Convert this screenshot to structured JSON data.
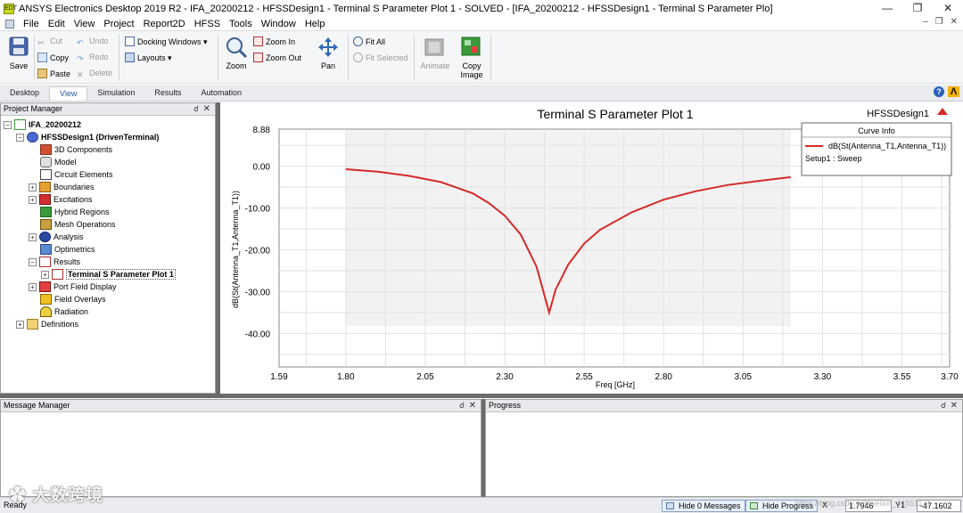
{
  "window": {
    "title": "ANSYS Electronics Desktop 2019 R2 - IFA_20200212 - HFSSDesign1 - Terminal S Parameter Plot 1 - SOLVED - [IFA_20200212 - HFSSDesign1 - Terminal S Parameter Plo]",
    "icon_text": "EDT"
  },
  "menu": [
    "File",
    "Edit",
    "View",
    "Project",
    "Report2D",
    "HFSS",
    "Tools",
    "Window",
    "Help"
  ],
  "ribbon": {
    "save": "Save",
    "cut": "Cut",
    "copy": "Copy",
    "paste": "Paste",
    "undo": "Undo",
    "redo": "Redo",
    "delete": "Delete",
    "docking_windows": "Docking Windows",
    "layouts": "Layouts",
    "zoom": "Zoom",
    "zoom_in": "Zoom In",
    "zoom_out": "Zoom Out",
    "pan": "Pan",
    "fit_all": "Fit All",
    "fit_selected": "Fit Selected",
    "animate": "Animate",
    "copy_image_1": "Copy",
    "copy_image_2": "Image"
  },
  "tabs": [
    "Desktop",
    "View",
    "Simulation",
    "Results",
    "Automation"
  ],
  "active_tab": "View",
  "project_manager": {
    "title": "Project Manager",
    "pin": "ᵖ",
    "close": "✕",
    "items": [
      {
        "label": "IFA_20200212",
        "bold": true
      },
      {
        "label": "HFSSDesign1 (DrivenTerminal)",
        "bold": true
      },
      {
        "label": "3D Components"
      },
      {
        "label": "Model"
      },
      {
        "label": "Circuit Elements"
      },
      {
        "label": "Boundaries"
      },
      {
        "label": "Excitations"
      },
      {
        "label": "Hybrid Regions"
      },
      {
        "label": "Mesh Operations"
      },
      {
        "label": "Analysis"
      },
      {
        "label": "Optimetrics"
      },
      {
        "label": "Results"
      },
      {
        "label": "Terminal S Parameter Plot 1",
        "bold": true
      },
      {
        "label": "Port Field Display"
      },
      {
        "label": "Field Overlays"
      },
      {
        "label": "Radiation"
      },
      {
        "label": "Definitions"
      }
    ]
  },
  "plot": {
    "title": "Terminal S Parameter Plot 1",
    "design_label": "HFSSDesign1",
    "curve_info_title": "Curve Info",
    "curve_name": "dB(St(Antenna_T1,Antenna_T1))",
    "curve_setup": "Setup1 : Sweep",
    "line_color": "#d42a2a"
  },
  "chart_data": {
    "type": "line",
    "title": "Terminal S Parameter Plot 1",
    "xlabel": "Freq [GHz]",
    "ylabel": "dB(St(Antenna_T1,Antenna_T1))",
    "xlim": [
      1.59,
      3.7
    ],
    "ylim": [
      -48.0,
      8.88
    ],
    "x_ticks": [
      "1.59",
      "1.80",
      "2.05",
      "2.30",
      "2.55",
      "2.80",
      "3.05",
      "3.30",
      "3.55",
      "3.70"
    ],
    "y_ticks": [
      "8.88",
      "0.00",
      "-10.00",
      "-20.00",
      "-30.00",
      "-40.00"
    ],
    "series": [
      {
        "name": "dB(St(Antenna_T1,Antenna_T1))",
        "x": [
          1.8,
          1.9,
          2.0,
          2.1,
          2.2,
          2.25,
          2.3,
          2.35,
          2.4,
          2.42,
          2.44,
          2.46,
          2.5,
          2.55,
          2.6,
          2.7,
          2.8,
          2.9,
          3.0,
          3.1,
          3.2
        ],
        "y": [
          -0.7,
          -1.3,
          -2.3,
          -3.8,
          -6.5,
          -8.8,
          -11.8,
          -16.3,
          -24.0,
          -29.5,
          -35.0,
          -29.5,
          -23.5,
          -18.5,
          -15.2,
          -11.0,
          -8.0,
          -6.0,
          -4.5,
          -3.5,
          -2.6
        ]
      }
    ]
  },
  "message_manager": {
    "title": "Message Manager"
  },
  "progress": {
    "title": "Progress"
  },
  "status": {
    "ready": "Ready",
    "hide_messages": "Hide 0 Messages",
    "hide_progress": "Hide Progress",
    "x_label": "X",
    "x_value": "1.7946",
    "y_label": "Y1",
    "y_value": "-47.1602"
  },
  "watermark": "大数跨境",
  "watermark_url": "https://blog.csdn.net/weixin_44551171"
}
